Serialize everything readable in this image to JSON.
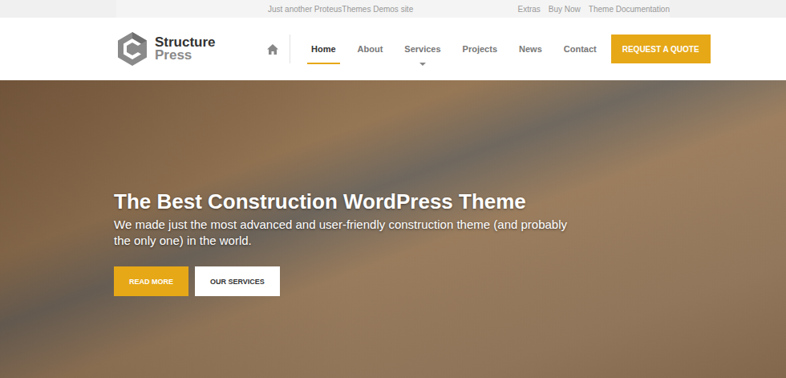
{
  "topbar": {
    "tagline": "Just another ProteusThemes Demos site",
    "links": [
      "Extras",
      "Buy Now",
      "Theme Documentation"
    ]
  },
  "logo": {
    "line1": "Structure",
    "line2": "Press"
  },
  "nav": {
    "items": [
      {
        "label": "Home",
        "selected": true,
        "has_submenu": false
      },
      {
        "label": "About",
        "selected": false,
        "has_submenu": false
      },
      {
        "label": "Services",
        "selected": false,
        "has_submenu": true
      },
      {
        "label": "Projects",
        "selected": false,
        "has_submenu": false
      },
      {
        "label": "News",
        "selected": false,
        "has_submenu": false
      },
      {
        "label": "Contact",
        "selected": false,
        "has_submenu": false
      }
    ]
  },
  "cta": "REQUEST A QUOTE",
  "hero": {
    "title": "The Best Construction WordPress Theme",
    "text": "We made just the most advanced and user-friendly construction theme (and probably the only one) in the world.",
    "buttons": [
      {
        "label": "READ MORE",
        "kind": "primary"
      },
      {
        "label": "OUR SERVICES",
        "kind": "secondary"
      }
    ]
  }
}
